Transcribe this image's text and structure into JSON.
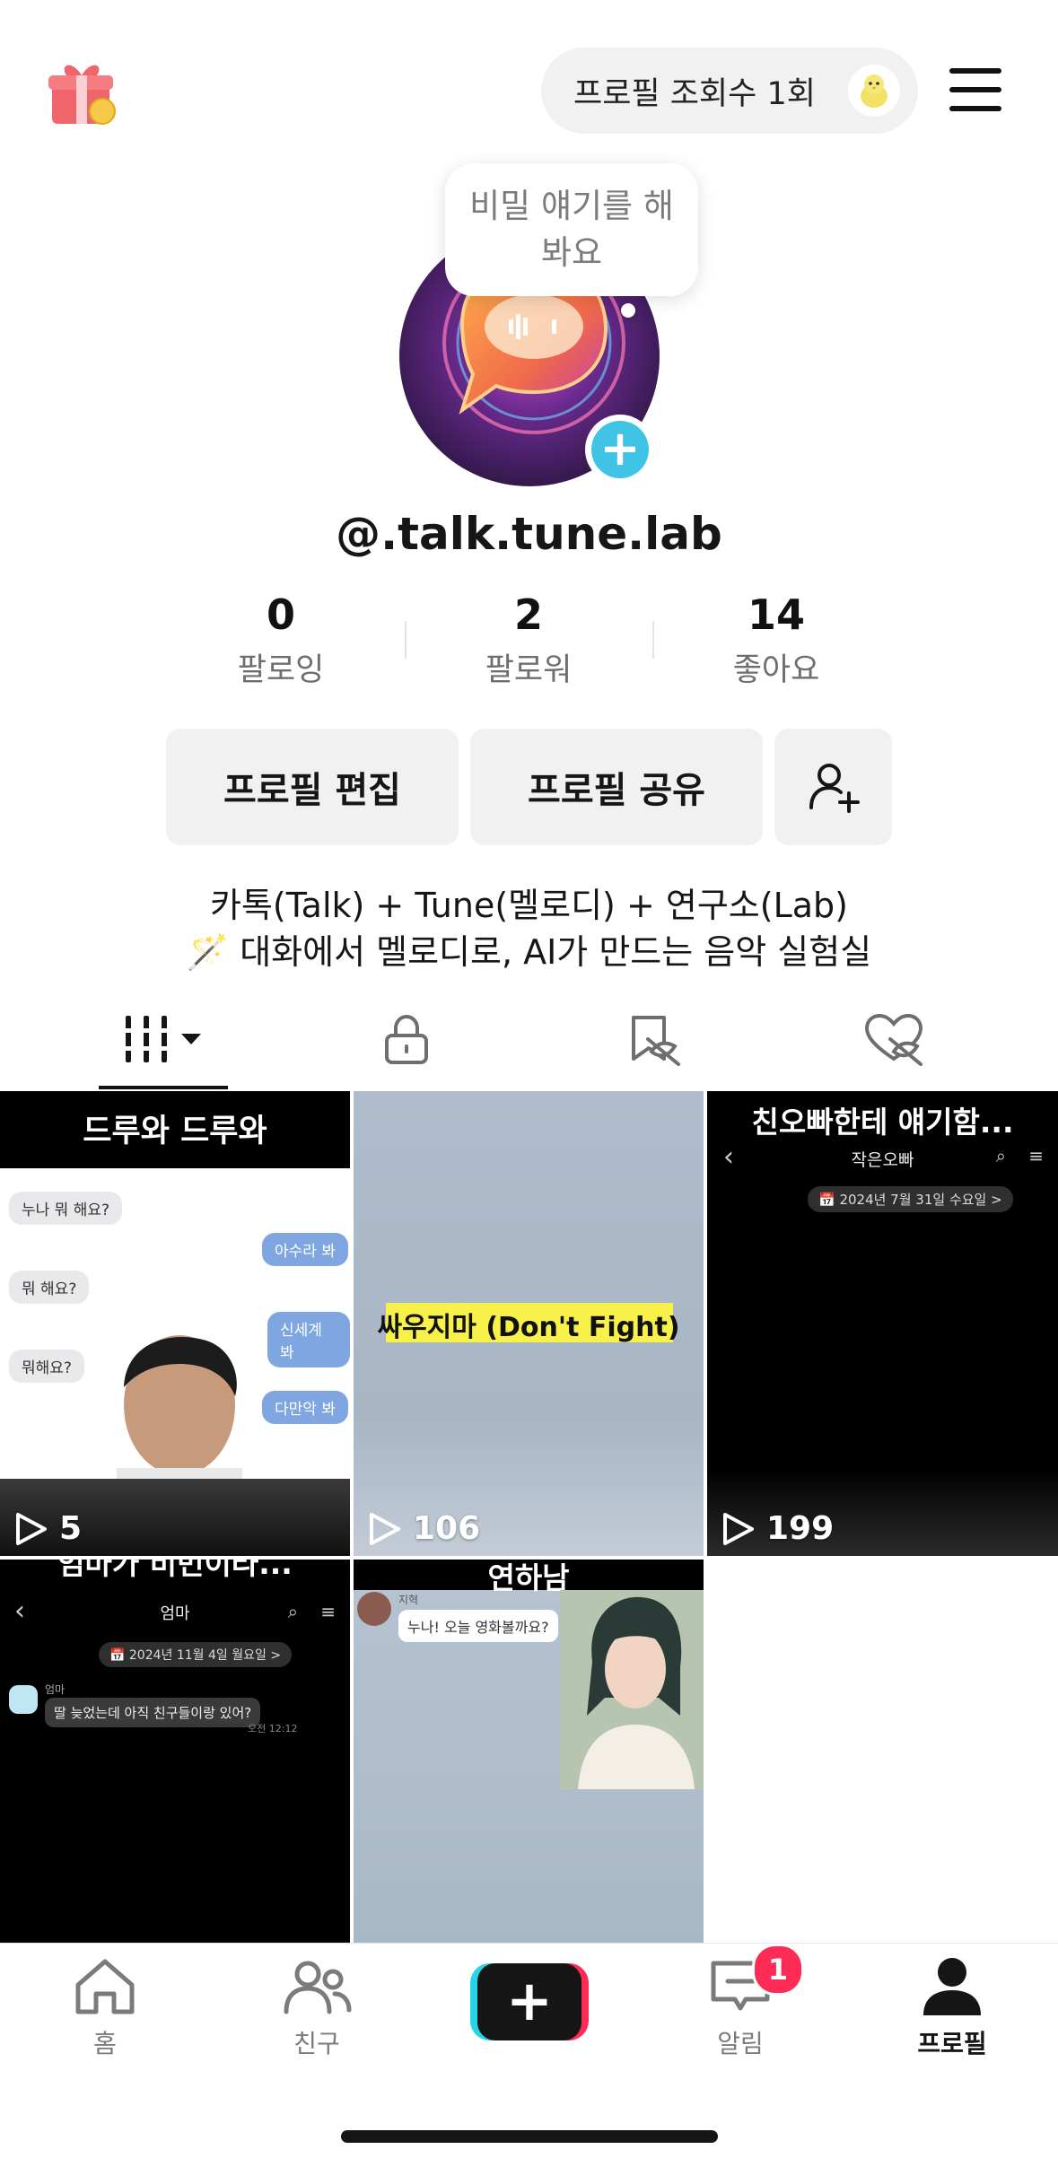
{
  "header": {
    "views_label": "프로필 조회수 1회"
  },
  "tooltip": {
    "text_line1": "비밀 얘기를 해",
    "text_line2": "봐요"
  },
  "profile": {
    "username": "@.talk.tune.lab",
    "stats": [
      {
        "value": "0",
        "label": "팔로잉"
      },
      {
        "value": "2",
        "label": "팔로워"
      },
      {
        "value": "14",
        "label": "좋아요"
      }
    ],
    "buttons": {
      "edit": "프로필 편집",
      "share": "프로필 공유"
    },
    "bio_line1": "카톡(Talk) + Tune(멜로디) + 연구소(Lab)",
    "bio_line2": "🪄 대화에서 멜로디로, AI가 만드는 음악 실험실"
  },
  "videos": [
    {
      "caption": "드루와 드루와",
      "plays": "5",
      "chat": [
        "누나 뭐 해요?",
        "아수라 봐",
        "뭐 해요?",
        "신세계 봐",
        "뭐해요?",
        "다만악 봐"
      ]
    },
    {
      "caption": "싸우지마 (Don't Fight)",
      "plays": "106"
    },
    {
      "caption": "친오빠한테 얘기함...",
      "plays": "199",
      "chat_title": "작은오빠",
      "date": "📅 2024년 7월 31일 수요일 >"
    },
    {
      "caption": "엄마가 비번이라...",
      "chat_title": "엄마",
      "date": "📅 2024년 11월 4일 월요일 >",
      "sender": "엄마",
      "message": "딸 늦었는데 아직 친구들이랑 있어?",
      "time": "오전 12:12"
    },
    {
      "caption": "연하남",
      "sender": "지혁",
      "message": "누나! 오늘 영화볼까요?"
    }
  ],
  "nav": {
    "home": "홈",
    "friends": "친구",
    "inbox": "알림",
    "profile": "프로필",
    "inbox_badge": "1"
  },
  "colors": {
    "accent_blue": "#3fc4e6",
    "badge_red": "#fe2c55"
  }
}
